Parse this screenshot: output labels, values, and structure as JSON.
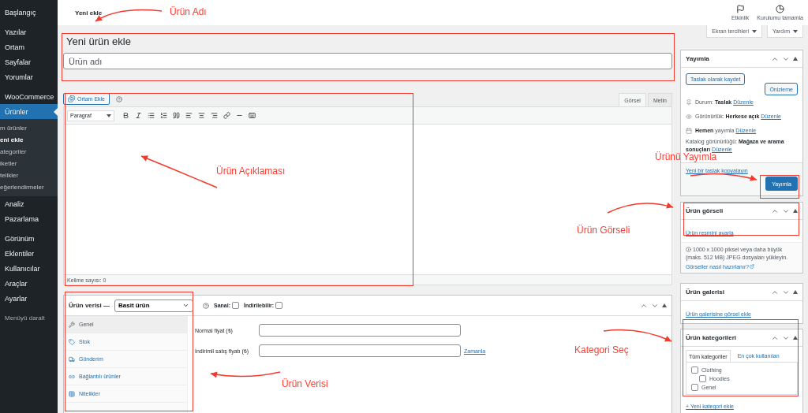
{
  "sidebar": {
    "groups": [
      {
        "items": [
          {
            "label": "Başlangıç",
            "selected": false
          }
        ]
      },
      {
        "items": [
          {
            "label": "Yazılar",
            "selected": false
          },
          {
            "label": "Ortam",
            "selected": false
          },
          {
            "label": "Sayfalar",
            "selected": false
          },
          {
            "label": "Yorumlar",
            "selected": false
          }
        ]
      },
      {
        "items": [
          {
            "label": "WooCommerce",
            "selected": false
          },
          {
            "label": "Ürünler",
            "selected": true,
            "children": [
              {
                "label": "m ürünler",
                "selected": false
              },
              {
                "label": "eni ekle",
                "selected": true
              },
              {
                "label": "ategoriler",
                "selected": false
              },
              {
                "label": "iketler",
                "selected": false
              },
              {
                "label": "telikler",
                "selected": false
              },
              {
                "label": "eğerlendirmeler",
                "selected": false
              }
            ]
          },
          {
            "label": "Analiz",
            "selected": false
          },
          {
            "label": "Pazarlama",
            "selected": false
          }
        ]
      },
      {
        "items": [
          {
            "label": "Görünüm",
            "selected": false
          },
          {
            "label": "Eklentiler",
            "selected": false
          },
          {
            "label": "Kullanıcılar",
            "selected": false
          },
          {
            "label": "Araçlar",
            "selected": false
          },
          {
            "label": "Ayarlar",
            "selected": false
          }
        ]
      }
    ],
    "collapse": "Menüyü daralt"
  },
  "topbar": {
    "title": "Yeni ekle",
    "actions": [
      {
        "label": "Etkinlik"
      },
      {
        "label": "Kurulumu tamamla"
      }
    ]
  },
  "screen_buttons": [
    "Ekran tercihleri",
    "Yardım"
  ],
  "heading": "Yeni ürün ekle",
  "title_field": {
    "placeholder": "Ürün adı"
  },
  "editor": {
    "media_button": "Ortam Ekle",
    "tabs": [
      {
        "label": "Görsel",
        "selected": true
      },
      {
        "label": "Metin",
        "selected": false
      }
    ],
    "format": "Paragraf",
    "word_count": "Kelime sayısı: 0"
  },
  "product_data": {
    "title": "Ürün verisi —",
    "type": "Basit ürün",
    "options": [
      {
        "label": "Sanal:",
        "checked": false
      },
      {
        "label": "İndirilebilir:",
        "checked": false
      }
    ],
    "tabs": [
      {
        "label": "Genel",
        "selected": true
      },
      {
        "label": "Stok",
        "selected": false
      },
      {
        "label": "Gönderim",
        "selected": false
      },
      {
        "label": "Bağlantılı ürünler",
        "selected": false
      },
      {
        "label": "Nitelikler",
        "selected": false
      }
    ],
    "fields": [
      {
        "label": "Normal fiyat (₺)"
      },
      {
        "label": "İndirimli satış fiyatı (₺)",
        "link": "Zamanla"
      }
    ]
  },
  "publish": {
    "title": "Yayımla",
    "save_draft": "Taslak olarak kaydet",
    "preview": "Önizleme",
    "meta": [
      {
        "text": "Durum: **Taslak**",
        "link": "Düzenle"
      },
      {
        "text": "Görünürlük: **Herkese açık**",
        "link": "Düzenle"
      },
      {
        "text": "**Hemen** yayımla",
        "link": "Düzenle"
      },
      {
        "text": "Katalog görünürlüğü: **Mağaza ve arama sonuçları**",
        "link": "Düzenle"
      }
    ],
    "copy_link": "Yeni bir taslak kopyalayın",
    "button": "Yayımla"
  },
  "product_image": {
    "title": "Ürün görseli",
    "link": "Ürün resmini ayarla",
    "hint": "1000 x 1000 piksel veya daha büyük (maks. 512 MB) JPEG dosyaları yükleyin.",
    "help": "Görseller nasıl hazırlanır?"
  },
  "gallery": {
    "title": "Ürün galerisi",
    "link": "Ürün galerisine görsel ekle"
  },
  "categories": {
    "title": "Ürün kategorileri",
    "tabs": [
      {
        "label": "Tüm kategoriler",
        "selected": true
      },
      {
        "label": "En çok kullanılan",
        "selected": false
      }
    ],
    "items": [
      {
        "label": "Clothing",
        "checked": false,
        "children": [
          {
            "label": "Hoodies",
            "checked": false
          }
        ]
      },
      {
        "label": "Genel",
        "checked": false
      }
    ],
    "add_link": "+ Yeni kategori ekle"
  },
  "annotations": [
    {
      "text": "Ürün Adı"
    },
    {
      "text": "Ürün Açıklaması"
    },
    {
      "text": "Ürünü Yayımla"
    },
    {
      "text": "Ürün Görseli"
    },
    {
      "text": "Kategori Seç"
    },
    {
      "text": "Ürün Verisi"
    }
  ]
}
